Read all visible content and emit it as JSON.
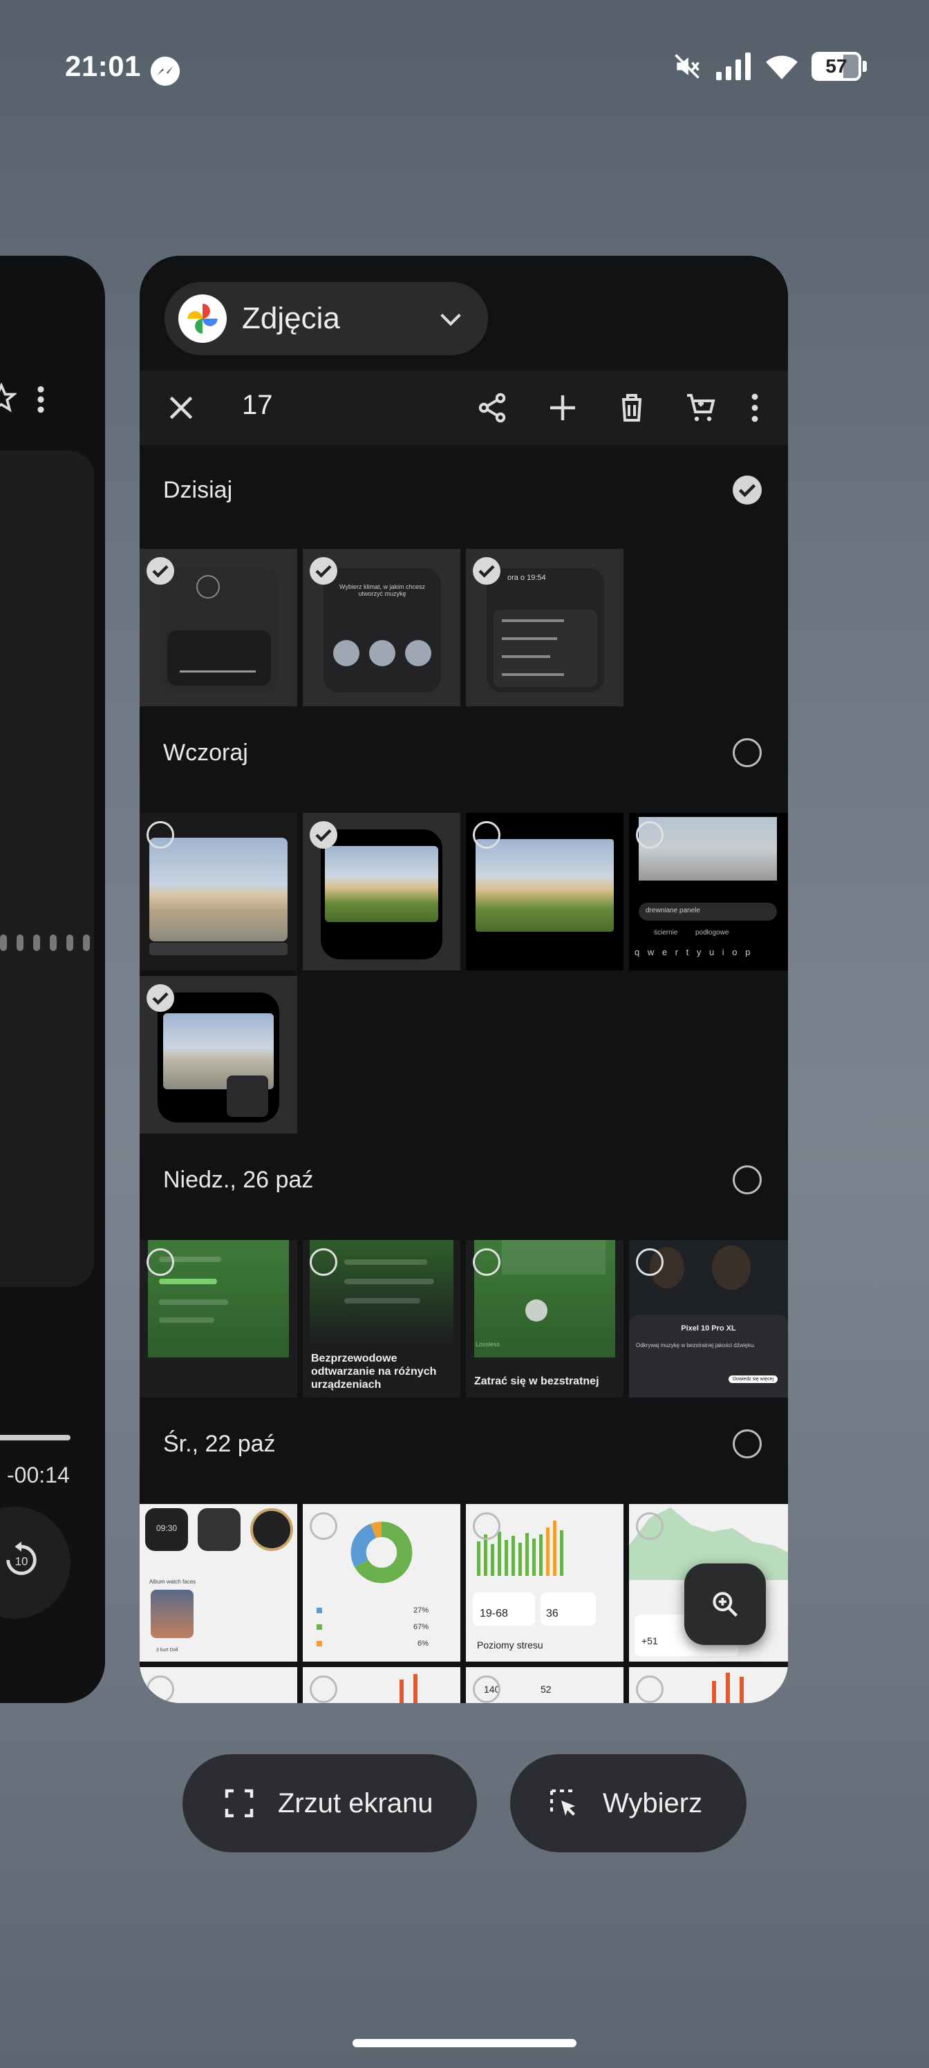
{
  "status_bar": {
    "time": "21:01",
    "battery": "57",
    "icons": [
      "messenger-icon",
      "mute-icon",
      "signal-icon",
      "wifi-icon",
      "battery-icon"
    ]
  },
  "left_card": {
    "time_remaining": "-00:14"
  },
  "app": {
    "name": "Zdjęcia",
    "icon": "google-photos-logo"
  },
  "toolbar": {
    "selected_count": "17",
    "icons": [
      "close-icon",
      "share-icon",
      "add-icon",
      "delete-icon",
      "cart-icon",
      "more-vert-icon"
    ]
  },
  "sections": [
    {
      "title": "Dzisiaj",
      "all_selected": true
    },
    {
      "title": "Wczoraj",
      "all_selected": false
    },
    {
      "title": "Niedz., 26 paź",
      "all_selected": false
    },
    {
      "title": "Śr., 22 paź",
      "all_selected": false
    }
  ],
  "thumb_text": {
    "t3_header": "ora o 19:54",
    "t2_text": "Wybierz klimat, w jakim chcesz utworzyć muzykę",
    "t4_input": "drewniane panele",
    "t4_keys": "q w e r t y u i o p",
    "t4_sugg1": "ściernie",
    "t4_sugg2": "podłogowe",
    "n2_text": "Bezprzewodowe odtwarzanie na różnych urządzeniach",
    "n3_text": "Zatrać się w bezstratnej",
    "n3_label": "Lossless",
    "n4_title": "Pixel 10 Pro XL",
    "n4_text": "Odkrywaj muzykę w bezstratnej jakości dźwięku.",
    "n4_btn": "Dowiedz się więcej",
    "s1_label": "Album watch faces",
    "s1_sub": "3 kurt Doll",
    "s1_time": "09:30",
    "s2_p1": "27%",
    "s2_p2": "67%",
    "s2_p3": "6%",
    "s3_range": "19-68",
    "s3_val": "36",
    "s3_title": "Poziomy stresu",
    "s3_b1": "140",
    "s3_b2": "52",
    "s4_val": "+51"
  },
  "buttons": {
    "screenshot": "Zrzut ekranu",
    "select": "Wybierz"
  },
  "colors": {
    "card_bg": "#111213",
    "toolbar_bg": "#1b1c1e",
    "chip_bg": "#2a2b2d",
    "accent_green": "#3f7a3a"
  }
}
